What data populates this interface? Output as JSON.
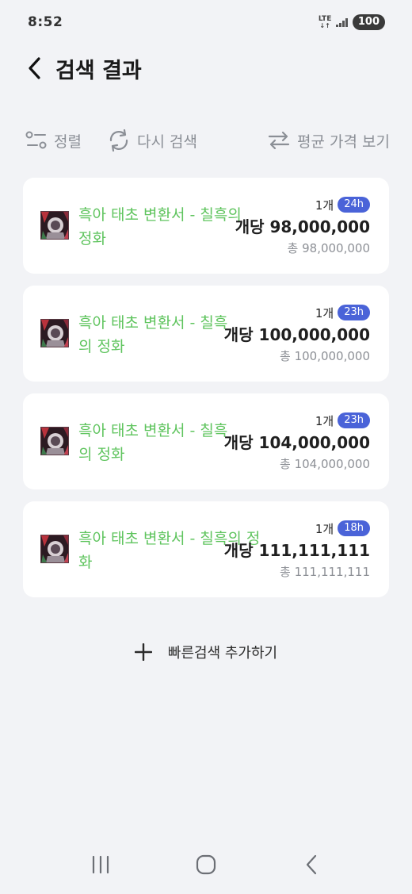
{
  "status_bar": {
    "time": "8:52",
    "network": "LTE",
    "battery": "100"
  },
  "header": {
    "title": "검색 결과"
  },
  "toolbar": {
    "sort_label": "정렬",
    "research_label": "다시 검색",
    "avg_price_label": "평균 가격 보기"
  },
  "results": [
    {
      "name_line1": "흑아 태초 변환서 - 칠흑의",
      "name_line2": "정화",
      "quantity": "1개",
      "time_left": "24h",
      "unit_price": "개당 98,000,000",
      "total_price": "총 98,000,000"
    },
    {
      "name_line1": "흑아 태초 변환서 - 칠흑",
      "name_line2": "의 정화",
      "quantity": "1개",
      "time_left": "23h",
      "unit_price": "개당 100,000,000",
      "total_price": "총 100,000,000"
    },
    {
      "name_line1": "흑아 태초 변환서 - 칠흑",
      "name_line2": "의 정화",
      "quantity": "1개",
      "time_left": "23h",
      "unit_price": "개당 104,000,000",
      "total_price": "총 104,000,000"
    },
    {
      "name_line1": "흑아 태초 변환서 - 칠흑의 정",
      "name_line2": "화",
      "quantity": "1개",
      "time_left": "18h",
      "unit_price": "개당 111,111,111",
      "total_price": "총 111,111,111"
    }
  ],
  "add_quick_search": {
    "label": "빠른검색 추가하기"
  },
  "colors": {
    "item_name": "#5fc45e",
    "badge": "#4a63d8",
    "background": "#f2f3f6"
  }
}
